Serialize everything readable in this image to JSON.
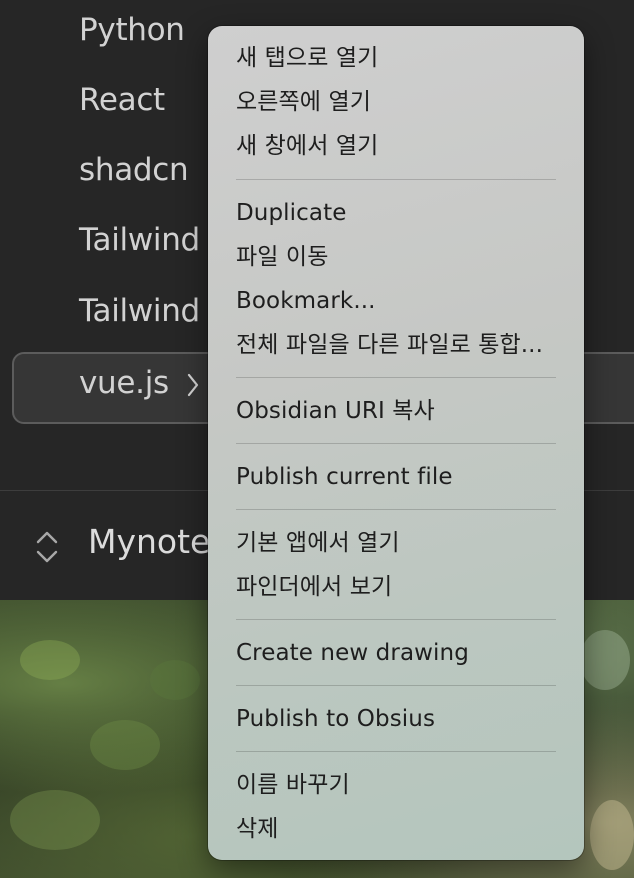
{
  "sidebar": {
    "items": [
      {
        "label": "Python"
      },
      {
        "label": "React"
      },
      {
        "label": "shadcn"
      },
      {
        "label": "Tailwind"
      },
      {
        "label": "Tailwind"
      },
      {
        "label": "vue.js"
      }
    ],
    "chevron_icon": "chevron-right-icon",
    "vault_switcher_icon": "up-down-chevron-icon",
    "vault_name": "Mynote"
  },
  "context_menu": {
    "open_new_tab": "새 탭으로 열기",
    "open_right": "오른쪽에 열기",
    "open_new_window": "새 창에서 열기",
    "duplicate": "Duplicate",
    "move_file": "파일 이동",
    "bookmark": "Bookmark...",
    "merge_file": "전체 파일을 다른 파일로 통합...",
    "copy_obsidian_uri": "Obsidian URI 복사",
    "publish_current_file": "Publish current file",
    "open_default_app": "기본 앱에서 열기",
    "reveal_in_finder": "파인더에서 보기",
    "create_new_drawing": "Create new drawing",
    "publish_to_obsius": "Publish to Obsius",
    "rename": "이름 바꾸기",
    "delete": "삭제"
  },
  "colors": {
    "sidebar_bg": "#262626",
    "sidebar_text": "#d2d2d2",
    "selected_border": "#5c5c5c",
    "menu_bg": "#c8c9c7",
    "menu_text": "#1e1e1e"
  }
}
